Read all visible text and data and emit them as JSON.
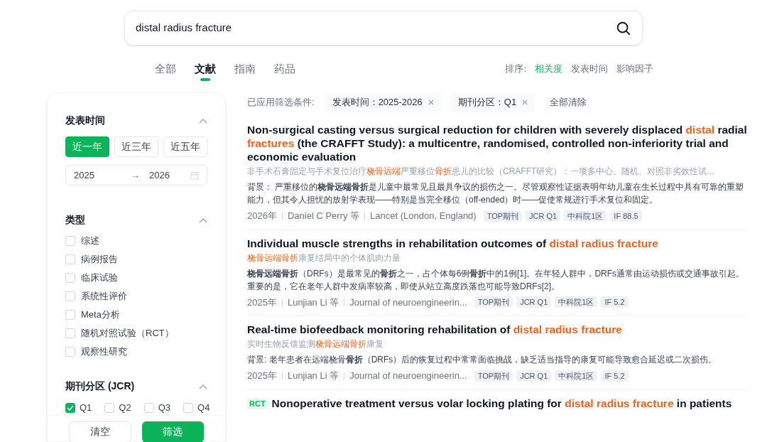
{
  "search": {
    "value": "distal radius fracture"
  },
  "tabs": [
    {
      "label": "全部",
      "selected": false
    },
    {
      "label": "文献",
      "selected": true
    },
    {
      "label": "指南",
      "selected": false
    },
    {
      "label": "药品",
      "selected": false
    }
  ],
  "sort": {
    "label": "排序:",
    "options": [
      {
        "label": "相关度",
        "selected": true
      },
      {
        "label": "发表时间",
        "selected": false
      },
      {
        "label": "影响因子",
        "selected": false
      }
    ]
  },
  "sidebar": {
    "time": {
      "title": "发表时间",
      "expanded": true,
      "presets": [
        {
          "label": "近一年",
          "selected": true
        },
        {
          "label": "近三年",
          "selected": false
        },
        {
          "label": "近五年",
          "selected": false
        }
      ],
      "from": "2025",
      "separator": "→",
      "to": "2026"
    },
    "type": {
      "title": "类型",
      "expanded": true,
      "items": [
        {
          "label": "综述",
          "checked": false
        },
        {
          "label": "病例报告",
          "checked": false
        },
        {
          "label": "临床试验",
          "checked": false
        },
        {
          "label": "系统性评价",
          "checked": false
        },
        {
          "label": "Meta分析",
          "checked": false
        },
        {
          "label": "随机对照试验（RCT）",
          "checked": false
        },
        {
          "label": "观察性研究",
          "checked": false
        }
      ]
    },
    "jcr": {
      "title": "期刊分区 (JCR)",
      "expanded": true,
      "items": [
        {
          "label": "Q1",
          "checked": true
        },
        {
          "label": "Q2",
          "checked": false
        },
        {
          "label": "Q3",
          "checked": false
        },
        {
          "label": "Q4",
          "checked": false
        }
      ]
    },
    "buttons": [
      "清空",
      "筛选"
    ]
  },
  "filters": {
    "label": "已应用筛选条件:",
    "chips": [
      "发表时间：2025-2026",
      "期刊分区：Q1"
    ],
    "clear": "全部清除"
  },
  "articles": [
    {
      "title": [
        {
          "text": "Non-surgical casting versus surgical reduction for children with severely displaced ",
          "hl": false
        },
        {
          "text": "distal",
          "hl": true
        },
        {
          "text": " radial ",
          "hl": false
        },
        {
          "text": "fractures",
          "hl": true
        },
        {
          "text": " (the CRAFFT Study): a multicentre, randomised, controlled non-inferiority trial and economic evaluation",
          "hl": false
        }
      ],
      "subtitle": [
        {
          "text": "非手术石膏固定与手术复位治疗",
          "hl": false
        },
        {
          "text": "桡骨远端",
          "hl": true
        },
        {
          "text": "严重移位",
          "hl": false
        },
        {
          "text": "骨折",
          "hl": true
        },
        {
          "text": "患儿的比较（CRAFFT研究）：一项多中心、随机、对照非劣效性试...",
          "hl": false
        }
      ],
      "abstract": "背景： 严重移位的**桡骨远端骨折**是儿童中最常见且最具争议的损伤之一。尽管观察性证据表明年幼儿童在生长过程中具有可靠的重塑能力，但其令人担忧的放射学表现——特别是当完全移位（off-ended）时——促使常规进行手术复位和固定。",
      "meta": [
        "2026年",
        "Daniel C Perry 等",
        "Lancet (London, England)"
      ],
      "tags": [
        "TOP期刊",
        "JCR Q1",
        "中科院1区",
        "IF 88.5"
      ]
    },
    {
      "title": [
        {
          "text": "Individual muscle strengths in rehabilitation outcomes of ",
          "hl": false
        },
        {
          "text": "distal radius fracture",
          "hl": true
        }
      ],
      "subtitle": [
        {
          "text": "桡骨远端骨折",
          "hl": true
        },
        {
          "text": "康复结局中的个体肌肉力量",
          "hl": false
        }
      ],
      "abstract": "**桡骨远端骨折**（DRFs）是最常见的**骨折**之一，占个体每6例**骨折**中的1例[1]。在年轻人群中，DRFs通常由运动损伤或交通事故引起。重要的是，它在老年人群中发病率较高，即使从站立高度跌落也可能导致DRFs[2]。",
      "meta": [
        "2025年",
        "Lunjian Li 等",
        "Journal of neuroengineerin..."
      ],
      "tags": [
        "TOP期刊",
        "JCR Q1",
        "中科院1区",
        "IF 5.2"
      ]
    },
    {
      "title": [
        {
          "text": "Real-time biofeedback monitoring rehabilitation of ",
          "hl": false
        },
        {
          "text": "distal radius fracture",
          "hl": true
        }
      ],
      "subtitle": [
        {
          "text": "实时生物反馈监测",
          "hl": false
        },
        {
          "text": "桡骨远端骨折",
          "hl": true
        },
        {
          "text": "康复",
          "hl": false
        }
      ],
      "abstract": "背景: 老年患者在远端桡骨**骨折**（DRFs）后的恢复过程中常常面临挑战，缺乏适当指导的康复可能导致愈合延迟或二次损伤。",
      "meta": [
        "2025年",
        "Lunjian Li 等",
        "Journal of neuroengineerin..."
      ],
      "tags": [
        "TOP期刊",
        "JCR Q1",
        "中科院1区",
        "IF 5.2"
      ]
    },
    {
      "badge": "RCT",
      "title": [
        {
          "text": "Nonoperative treatment versus volar locking plating for ",
          "hl": false
        },
        {
          "text": "distal radius fracture",
          "hl": true
        },
        {
          "text": " in patients",
          "hl": false
        }
      ]
    }
  ]
}
